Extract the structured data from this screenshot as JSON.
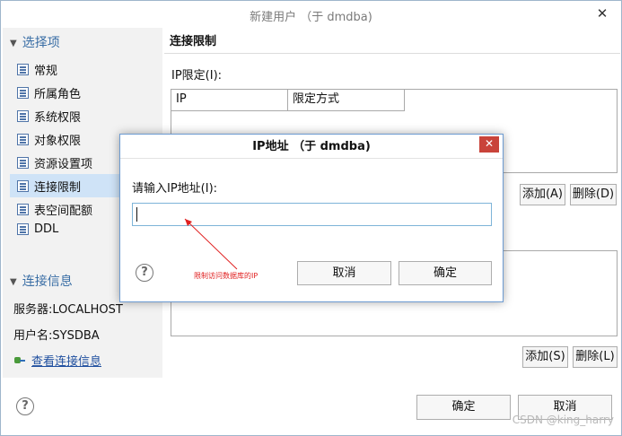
{
  "window": {
    "title": "新建用户 （于 dmdba)",
    "close_glyph": "✕"
  },
  "sidebar": {
    "options_header": "选择项",
    "items": [
      {
        "label": "常规",
        "active": false
      },
      {
        "label": "所属角色",
        "active": false
      },
      {
        "label": "系统权限",
        "active": false
      },
      {
        "label": "对象权限",
        "active": false
      },
      {
        "label": "资源设置项",
        "active": false
      },
      {
        "label": "连接限制",
        "active": true
      },
      {
        "label": "表空间配额",
        "active": false
      },
      {
        "label": "DDL",
        "active": false
      }
    ],
    "conn_header": "连接信息",
    "server": "服务器:LOCALHOST",
    "username": "用户名:SYSDBA",
    "view_conn_link": "查看连接信息"
  },
  "panel": {
    "title": "连接限制",
    "ip_label": "IP限定(I):",
    "columns": [
      "IP",
      "限定方式"
    ],
    "add_ip": "添加(A)",
    "delete_ip": "删除(D)",
    "add_s": "添加(S)",
    "delete_l": "删除(L)"
  },
  "footer": {
    "ok": "确定",
    "cancel": "取消",
    "help": "?"
  },
  "dialog": {
    "title": "IP地址 （于 dmdba)",
    "close_glyph": "✕",
    "prompt": "请输入IP地址(I):",
    "input_value": "",
    "help": "?",
    "cancel": "取消",
    "ok": "确定",
    "annotation": "限制访问数据库的IP"
  },
  "watermark": "CSDN @king_harry",
  "colors": {
    "accent": "#3a6ea5",
    "selection": "#cfe3f7",
    "close_red": "#c9433a",
    "annotation": "#e02020"
  }
}
